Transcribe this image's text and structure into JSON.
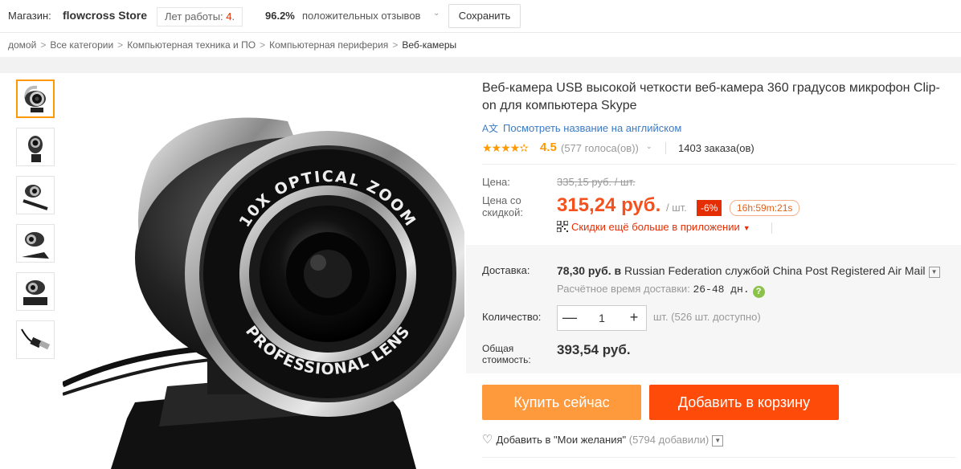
{
  "store": {
    "label": "Магазин:",
    "name": "flowcross Store",
    "years_label": "Лет работы:",
    "years_value": "4",
    "years_suffix": ".",
    "positive_pct": "96.2%",
    "positive_label": "положительных отзывов",
    "save_label": "Сохранить"
  },
  "breadcrumb": {
    "items": [
      "домой",
      "Все категории",
      "Компьютерная техника и ПО",
      "Компьютерная периферия"
    ],
    "current": "Веб-камеры",
    "separator": ">"
  },
  "gallery": {
    "thumbnails": [
      "webcam-front",
      "webcam-side",
      "webcam-clip",
      "webcam-angle",
      "webcam-stand",
      "usb-cable"
    ],
    "active_index": 0,
    "main_image": "webcam-main",
    "lens_text_top": "10X OPTICAL ZOOM",
    "lens_text_bottom": "PROFESSIONAL LENS"
  },
  "product": {
    "title": "Веб-камера USB высокой четкости веб-камера 360 градусов микрофон Clip-on для компьютера Skype",
    "translate_link": "Посмотреть название на английском",
    "rating": "4.5",
    "stars": "★★★★✫",
    "votes": "(577 голоса(ов))",
    "orders": "1403 заказа(ов)"
  },
  "price": {
    "price_label": "Цена:",
    "old_price": "335,15 руб. / шт.",
    "discount_label_1": "Цена со",
    "discount_label_2": "скидкой:",
    "new_price": "315,24 руб.",
    "per_unit": "/ шт.",
    "discount_badge": "-6%",
    "timer": "16h:59m:21s",
    "app_discount": "Скидки ещё больше в приложении"
  },
  "shipping": {
    "label": "Доставка:",
    "cost": "78,30 руб.",
    "in": "в",
    "destination": "Russian Federation",
    "via": "службой China Post Registered Air Mail",
    "eta_label": "Расчётное время доставки:",
    "eta_days": "26-48 дн.",
    "help": "?"
  },
  "quantity": {
    "label": "Количество:",
    "value": "1",
    "minus": "—",
    "plus": "+",
    "available": "шт. (526 шт. доступно)"
  },
  "total": {
    "label_1": "Общая",
    "label_2": "стоимость:",
    "value": "393,54 руб."
  },
  "actions": {
    "buy_now": "Купить сейчас",
    "add_to_cart": "Добавить в корзину",
    "wishlist": "Добавить в \"Мои желания\"",
    "wishlist_count": "(5794 добавили)"
  },
  "colors": {
    "accent_orange": "#ff9a3c",
    "cart_red": "#ff4b0a",
    "price_red": "#f5511e",
    "link_blue": "#3b7bc4",
    "star": "#ff9900"
  }
}
